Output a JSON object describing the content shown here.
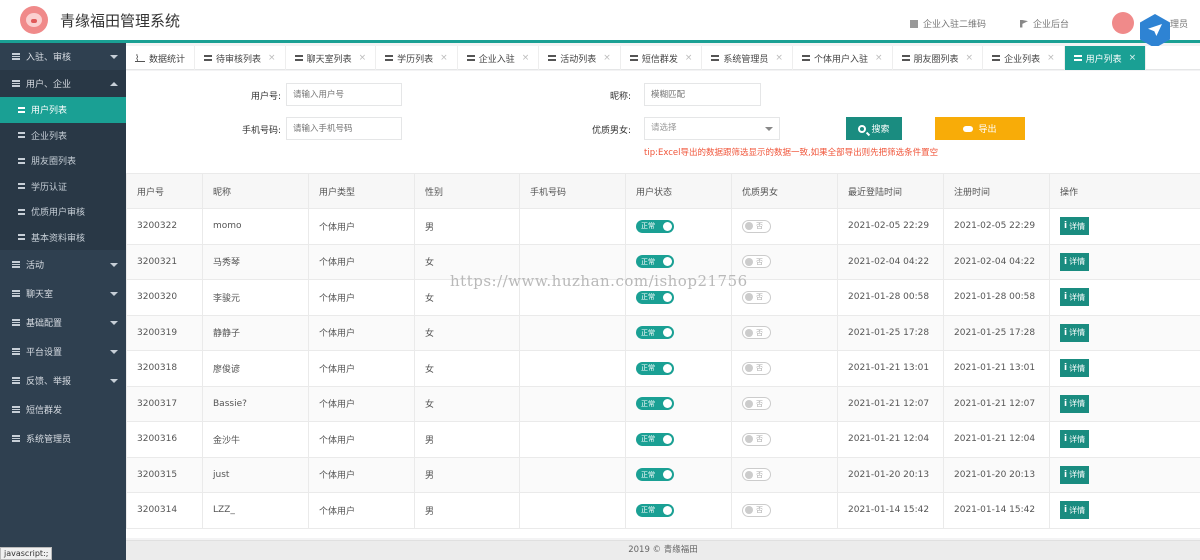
{
  "header": {
    "title": "青缘福田管理系统",
    "links": [
      "企业入驻二维码",
      "企业后台"
    ],
    "user_name": "理员"
  },
  "sidebar": {
    "groups_top": [
      {
        "label": "入驻、审核",
        "open": false
      },
      {
        "label": "用户、企业",
        "open": true
      }
    ],
    "sub_items": [
      {
        "label": "用户列表",
        "active": true
      },
      {
        "label": "企业列表",
        "active": false
      },
      {
        "label": "朋友圈列表",
        "active": false
      },
      {
        "label": "学历认证",
        "active": false
      },
      {
        "label": "优质用户审核",
        "active": false
      },
      {
        "label": "基本资料审核",
        "active": false
      }
    ],
    "groups_bottom": [
      {
        "label": "活动",
        "caret": true
      },
      {
        "label": "聊天室",
        "caret": true
      },
      {
        "label": "基础配置",
        "caret": true
      },
      {
        "label": "平台设置",
        "caret": true
      },
      {
        "label": "反馈、举报",
        "caret": true
      },
      {
        "label": "短信群发",
        "caret": false
      },
      {
        "label": "系统管理员",
        "caret": false
      }
    ],
    "status_tip": "javascript:;"
  },
  "tabs": [
    {
      "label": "数据统计",
      "closable": false,
      "active": false
    },
    {
      "label": "待审核列表",
      "closable": true,
      "active": false
    },
    {
      "label": "聊天室列表",
      "closable": true,
      "active": false
    },
    {
      "label": "学历列表",
      "closable": true,
      "active": false
    },
    {
      "label": "企业入驻",
      "closable": true,
      "active": false
    },
    {
      "label": "活动列表",
      "closable": true,
      "active": false
    },
    {
      "label": "短信群发",
      "closable": true,
      "active": false
    },
    {
      "label": "系统管理员",
      "closable": true,
      "active": false
    },
    {
      "label": "个体用户入驻",
      "closable": true,
      "active": false
    },
    {
      "label": "朋友圈列表",
      "closable": true,
      "active": false
    },
    {
      "label": "企业列表",
      "closable": true,
      "active": false
    },
    {
      "label": "用户列表",
      "closable": true,
      "active": true
    }
  ],
  "search": {
    "user_id_label": "用户号:",
    "user_id_placeholder": "请输入用户号",
    "nickname_label": "昵称:",
    "nickname_placeholder": "模糊匹配",
    "phone_label": "手机号码:",
    "phone_placeholder": "请输入手机号码",
    "quality_label": "优质男女:",
    "quality_placeholder": "请选择",
    "search_button": "搜索",
    "export_button": "导出",
    "tip": "tip:Excel导出的数据跟筛选显示的数据一致,如果全部导出则先把筛选条件置空"
  },
  "table": {
    "columns": [
      "用户号",
      "昵称",
      "用户类型",
      "性别",
      "手机号码",
      "用户状态",
      "优质男女",
      "最近登陆时间",
      "注册时间",
      "操作"
    ],
    "status_on_label": "正常",
    "quality_off_label": "否",
    "detail_label": "详情",
    "rows": [
      {
        "id": "3200322",
        "nickname": "momo",
        "type": "个体用户",
        "gender": "男",
        "phone": "",
        "last_login": "2021-02-05 22:29",
        "registered": "2021-02-05 22:29"
      },
      {
        "id": "3200321",
        "nickname": "马秀琴",
        "type": "个体用户",
        "gender": "女",
        "phone": "",
        "last_login": "2021-02-04 04:22",
        "registered": "2021-02-04 04:22"
      },
      {
        "id": "3200320",
        "nickname": "李骏元",
        "type": "个体用户",
        "gender": "女",
        "phone": "",
        "last_login": "2021-01-28 00:58",
        "registered": "2021-01-28 00:58"
      },
      {
        "id": "3200319",
        "nickname": "静静子",
        "type": "个体用户",
        "gender": "女",
        "phone": "",
        "last_login": "2021-01-25 17:28",
        "registered": "2021-01-25 17:28"
      },
      {
        "id": "3200318",
        "nickname": "廖俊谚",
        "type": "个体用户",
        "gender": "女",
        "phone": "",
        "last_login": "2021-01-21 13:01",
        "registered": "2021-01-21 13:01"
      },
      {
        "id": "3200317",
        "nickname": "Bassie?",
        "type": "个体用户",
        "gender": "女",
        "phone": "",
        "last_login": "2021-01-21 12:07",
        "registered": "2021-01-21 12:07"
      },
      {
        "id": "3200316",
        "nickname": "金沙牛",
        "type": "个体用户",
        "gender": "男",
        "phone": "",
        "last_login": "2021-01-21 12:04",
        "registered": "2021-01-21 12:04"
      },
      {
        "id": "3200315",
        "nickname": "just",
        "type": "个体用户",
        "gender": "男",
        "phone": "",
        "last_login": "2021-01-20 20:13",
        "registered": "2021-01-20 20:13"
      },
      {
        "id": "3200314",
        "nickname": "LZZ_",
        "type": "个体用户",
        "gender": "男",
        "phone": "",
        "last_login": "2021-01-14 15:42",
        "registered": "2021-01-14 15:42"
      }
    ]
  },
  "footer": {
    "text": "2019 © 青缘福田"
  },
  "watermark": "https://www.huzhan.com/ishop21756",
  "colors": {
    "accent": "#1aa094",
    "sidebar": "#2f4050",
    "export": "#f8ac08",
    "tip": "#f0553a"
  }
}
